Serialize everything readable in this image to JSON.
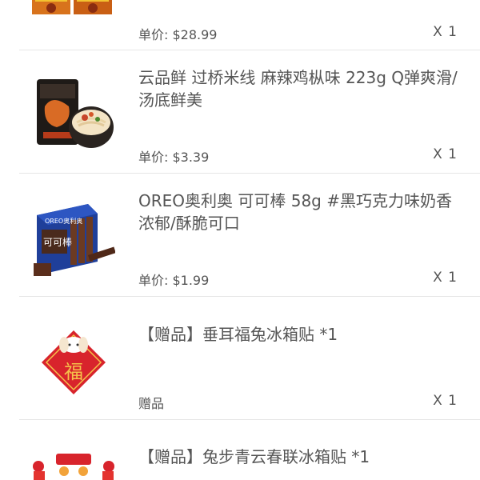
{
  "items": [
    {
      "title": "",
      "price_label": "单价: $28.99",
      "qty_label": "X 1",
      "image": "noodle-pack-image"
    },
    {
      "title": "云品鲜 过桥米线 麻辣鸡枞味 223g Q弹爽滑/汤底鲜美",
      "price_label": "单价: $3.39",
      "qty_label": "X 1",
      "image": "rice-noodle-bowl-image"
    },
    {
      "title": "OREO奥利奥 可可棒 58g #黑巧克力味奶香浓郁/酥脆可口",
      "price_label": "单价: $1.99",
      "qty_label": "X 1",
      "image": "oreo-box-image",
      "image_text": "可可棒",
      "image_brand": "OREO奥利奥"
    },
    {
      "title": "【赠品】垂耳福兔冰箱贴 *1",
      "price_label": "赠品",
      "qty_label": "X 1",
      "image": "fu-rabbit-magnet-image",
      "image_text": "福"
    },
    {
      "title": "【赠品】兔步青云春联冰箱贴 *1",
      "price_label": "",
      "qty_label": "",
      "image": "couplet-magnet-image"
    }
  ]
}
